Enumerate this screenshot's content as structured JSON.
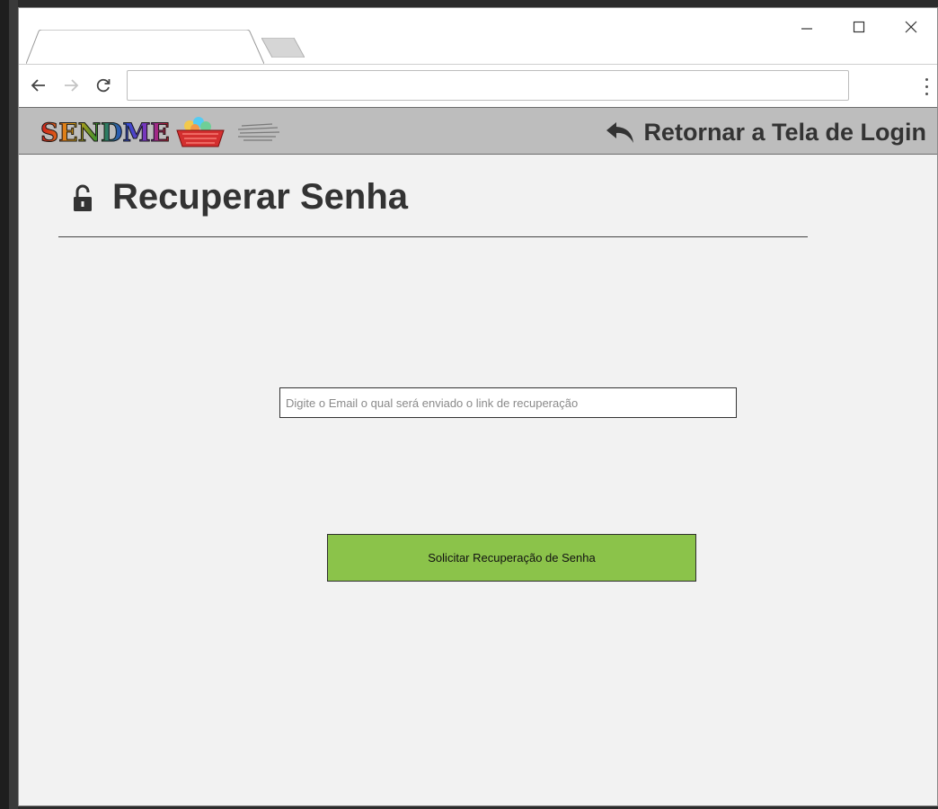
{
  "browser": {
    "url": "",
    "controls": {
      "minimize_icon": "minimize-icon",
      "maximize_icon": "maximize-icon",
      "close_icon": "close-icon"
    }
  },
  "header": {
    "logo_text": "SENDME",
    "return_label": "Retornar a Tela de Login"
  },
  "page": {
    "title": "Recuperar Senha"
  },
  "form": {
    "email_value": "",
    "email_placeholder": "Digite o Email o qual será enviado o link de recuperação",
    "submit_label": "Solicitar Recuperação de Senha"
  },
  "colors": {
    "header_bg": "#bdbdbd",
    "page_bg": "#f2f2f2",
    "button_bg": "#8bc34a",
    "title_text": "#333333"
  }
}
